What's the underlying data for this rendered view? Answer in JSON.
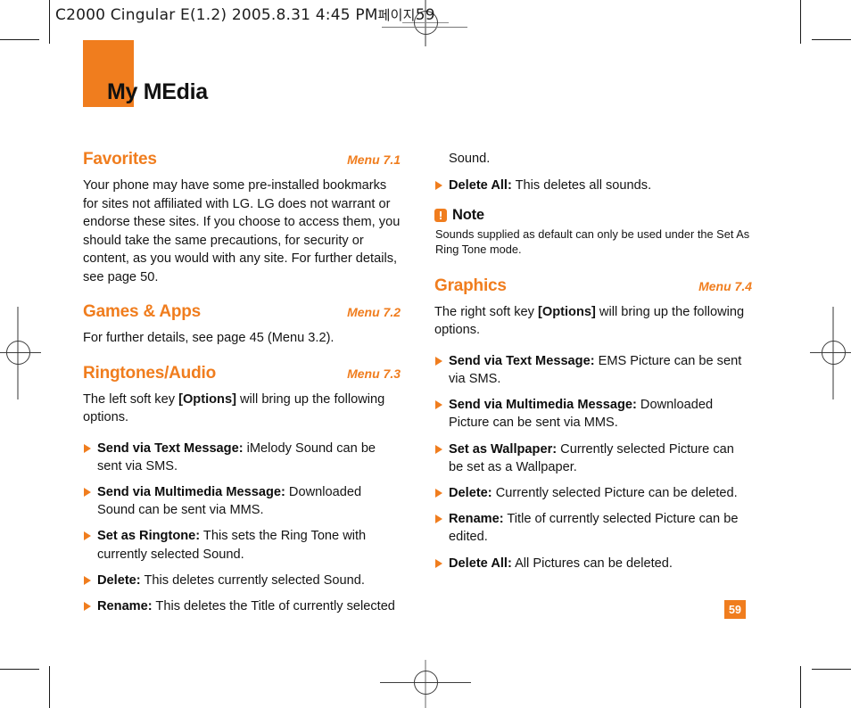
{
  "print_header": {
    "text": "C2000 Cingular  E(1.2)  2005.8.31 4:45 PM",
    "korean_page_label": "페이지",
    "page_value": "59"
  },
  "chapter": {
    "title": "My MEdia",
    "accent_color": "#F07D1E"
  },
  "page_number": "59",
  "left_column": {
    "sections": [
      {
        "title": "Favorites",
        "menu": "Menu 7.1",
        "body": "Your phone may have some pre-installed bookmarks for sites not affiliated with LG. LG does not warrant or endorse these sites. If you choose to access them, you should take the same precautions, for security or content, as you would with any site. For further details, see page 50."
      },
      {
        "title": "Games & Apps",
        "menu": "Menu 7.2",
        "body": "For further details, see page 45 (Menu 3.2)."
      },
      {
        "title": "Ringtones/Audio",
        "menu": "Menu 7.3",
        "intro_pre": "The left soft key  ",
        "intro_bold": "[Options]",
        "intro_post": " will bring up the following options."
      }
    ],
    "bullets": [
      {
        "label": "Send via Text Message:",
        "text": " iMelody Sound can be sent via SMS."
      },
      {
        "label": "Send via Multimedia Message:",
        "text": " Downloaded Sound can be sent via MMS."
      },
      {
        "label": "Set as Ringtone:",
        "text": " This sets the Ring Tone with currently selected Sound."
      },
      {
        "label": "Delete:",
        "text": " This deletes currently selected Sound."
      },
      {
        "label": "Rename:",
        "text": " This deletes the Title of currently selected"
      }
    ]
  },
  "right_column": {
    "continuation": "Sound.",
    "bullets_top": [
      {
        "label": "Delete All:",
        "text": " This deletes all sounds."
      }
    ],
    "note": {
      "title": "Note",
      "body": "Sounds supplied as default can only be used under the Set As Ring Tone mode."
    },
    "section": {
      "title": "Graphics",
      "menu": "Menu 7.4",
      "intro_pre": "The right soft key ",
      "intro_bold": "[Options]",
      "intro_post": " will bring up the following options."
    },
    "bullets": [
      {
        "label": "Send via Text Message:",
        "text": " EMS Picture can be sent via SMS."
      },
      {
        "label": "Send via Multimedia Message:",
        "text": " Downloaded Picture can be sent via MMS."
      },
      {
        "label": "Set as Wallpaper:",
        "text": " Currently selected Picture can be set as a Wallpaper."
      },
      {
        "label": "Delete:",
        "text": " Currently selected Picture can be deleted."
      },
      {
        "label": "Rename:",
        "text": " Title of currently selected Picture can be edited."
      },
      {
        "label": "Delete All:",
        "text": " All Pictures can be deleted."
      }
    ]
  }
}
